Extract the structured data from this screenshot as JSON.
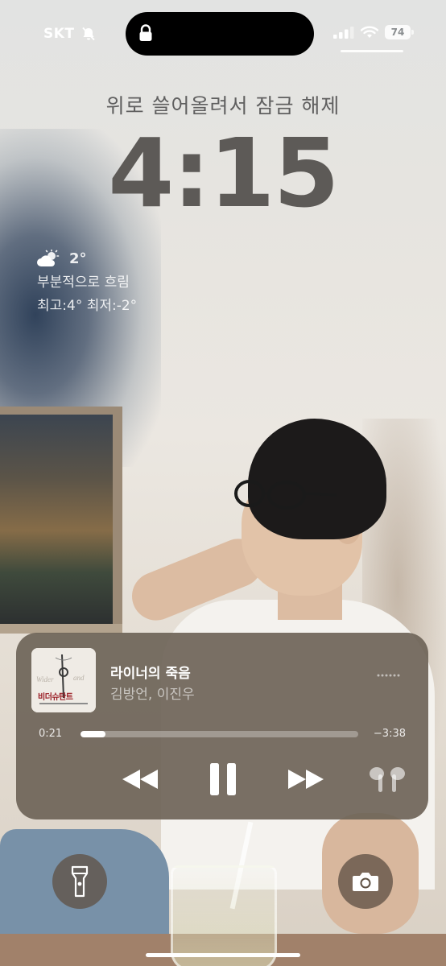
{
  "status_bar": {
    "carrier": "SKT",
    "battery": "74",
    "icons": [
      "bell-slash-icon",
      "lock-icon",
      "signal-icon",
      "wifi-icon",
      "battery-icon"
    ]
  },
  "lock_screen": {
    "unlock_hint": "위로 쓸어올려서 잠금 해제",
    "time": "4:15"
  },
  "weather": {
    "icon": "partly-cloudy-icon",
    "temperature": "2°",
    "condition": "부분적으로 흐림",
    "high_low": "최고:4° 최저:-2°"
  },
  "now_playing": {
    "title": "라이너의 죽음",
    "artist": "김방언, 이진우",
    "album_art_text": "비더슈탄트",
    "elapsed": "0:21",
    "remaining": "−3:38",
    "progress": 0.09
  },
  "controls": {
    "rewind": "rewind-icon",
    "pause": "pause-icon",
    "forward": "fast-forward-icon",
    "output": "airpods-icon"
  },
  "bottom_buttons": {
    "left": "flashlight-icon",
    "right": "camera-icon"
  },
  "colors": {
    "clock": "#5d5a57",
    "player_bg": "#6e6458",
    "button_bg": "#605246"
  }
}
